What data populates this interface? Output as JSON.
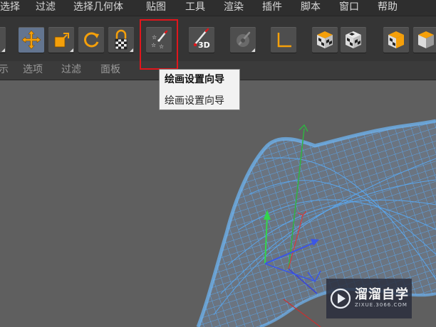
{
  "menu": {
    "items": [
      "选择",
      "过滤",
      "选择几何体",
      "贴图",
      "工具",
      "渲染",
      "插件",
      "脚本",
      "窗口",
      "帮助"
    ]
  },
  "toolbar": {
    "buttons": [
      {
        "icon": "transform-tool-icon"
      },
      {
        "icon": "move-icon",
        "active": true
      },
      {
        "icon": "scale-icon"
      },
      {
        "icon": "rotate-icon"
      },
      {
        "icon": "lock-tool-icon"
      },
      {
        "icon": "paint-setup-wizard-icon"
      },
      {
        "icon": "paint-3d-icon",
        "text": "3D"
      },
      {
        "icon": "disabled-brush-icon"
      },
      {
        "icon": "axis-corner-icon"
      },
      {
        "icon": "checker-cube-icon"
      },
      {
        "icon": "checker-cube-icon-2"
      },
      {
        "icon": "checker-cube-icon-3"
      },
      {
        "icon": "cube-icon"
      }
    ],
    "accent": "#f5a00a"
  },
  "tabs": {
    "items": [
      "示",
      "选项",
      "过滤",
      "面板"
    ]
  },
  "tooltip": {
    "title": "绘画设置向导",
    "description": "绘画设置向导"
  },
  "highlight_color": "#e0161c",
  "watermark": {
    "title": "溜溜自学",
    "url": "ZIXUE.3066.COM"
  },
  "viewport": {
    "background": "#5f5f5f",
    "wire_color": "#5aa6ec"
  }
}
